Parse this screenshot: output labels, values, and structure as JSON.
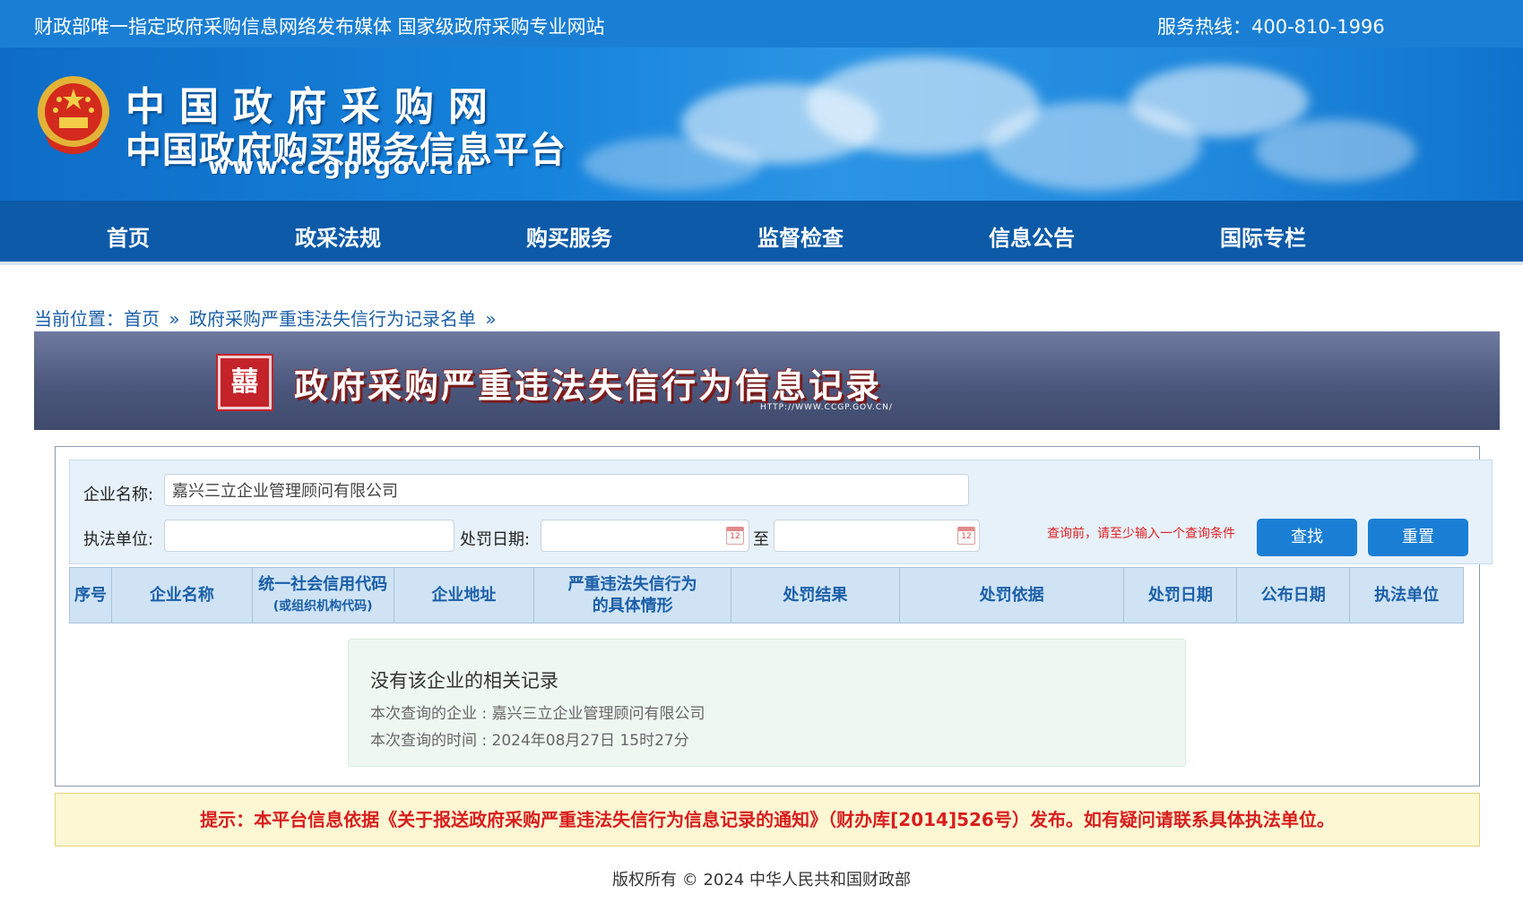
{
  "top_bar": {
    "slogan": "财政部唯一指定政府采购信息网络发布媒体 国家级政府采购专业网站",
    "hotline": "服务热线：400-810-1996"
  },
  "header": {
    "logo_title": "中国政府采购网",
    "logo_subtitle": "中国政府购买服务信息平台",
    "logo_url": "www.ccgp.gov.cn"
  },
  "nav": {
    "items": [
      "首页",
      "政采法规",
      "购买服务",
      "监督检查",
      "信息公告",
      "国际专栏"
    ]
  },
  "breadcrumb": {
    "prefix": "当前位置：",
    "home": "首页",
    "sep": "»",
    "current": "政府采购严重违法失信行为记录名单"
  },
  "title_banner": {
    "title": "政府采购严重违法失信行为信息记录",
    "url": "HTTP://WWW.CCGP.GOV.CN/"
  },
  "search": {
    "company_label": "企业名称:",
    "company_value": "嘉兴三立企业管理顾问有限公司",
    "agency_label": "执法单位:",
    "agency_value": "",
    "date_label": "处罚日期:",
    "date_from": "",
    "date_to": "",
    "to_label": "至",
    "hint": "查询前，请至少输入一个查询条件",
    "search_button": "查找",
    "reset_button": "重置"
  },
  "table": {
    "headers": [
      {
        "main": "序号",
        "sub": ""
      },
      {
        "main": "企业名称",
        "sub": ""
      },
      {
        "main": "统一社会信用代码",
        "sub": "(或组织机构代码)"
      },
      {
        "main": "企业地址",
        "sub": ""
      },
      {
        "main": "严重违法失信行为",
        "sub": "的具体情形"
      },
      {
        "main": "处罚结果",
        "sub": ""
      },
      {
        "main": "处罚依据",
        "sub": ""
      },
      {
        "main": "处罚日期",
        "sub": ""
      },
      {
        "main": "公布日期",
        "sub": ""
      },
      {
        "main": "执法单位",
        "sub": ""
      }
    ]
  },
  "result": {
    "message": "没有该企业的相关记录",
    "company_line": "本次查询的企业 : 嘉兴三立企业管理顾问有限公司",
    "time_line": "本次查询的时间 : 2024年08月27日 15时27分"
  },
  "notice": "提示：本平台信息依据《关于报送政府采购严重违法失信行为信息记录的通知》（财办库[2014]526号）发布。如有疑问请联系具体执法单位。",
  "footer": "版权所有 © 2024 中华人民共和国财政部",
  "colors": {
    "brand_blue": "#1a7fd4",
    "nav_blue": "#0c5aa8",
    "alert_red": "#d81e1e"
  }
}
